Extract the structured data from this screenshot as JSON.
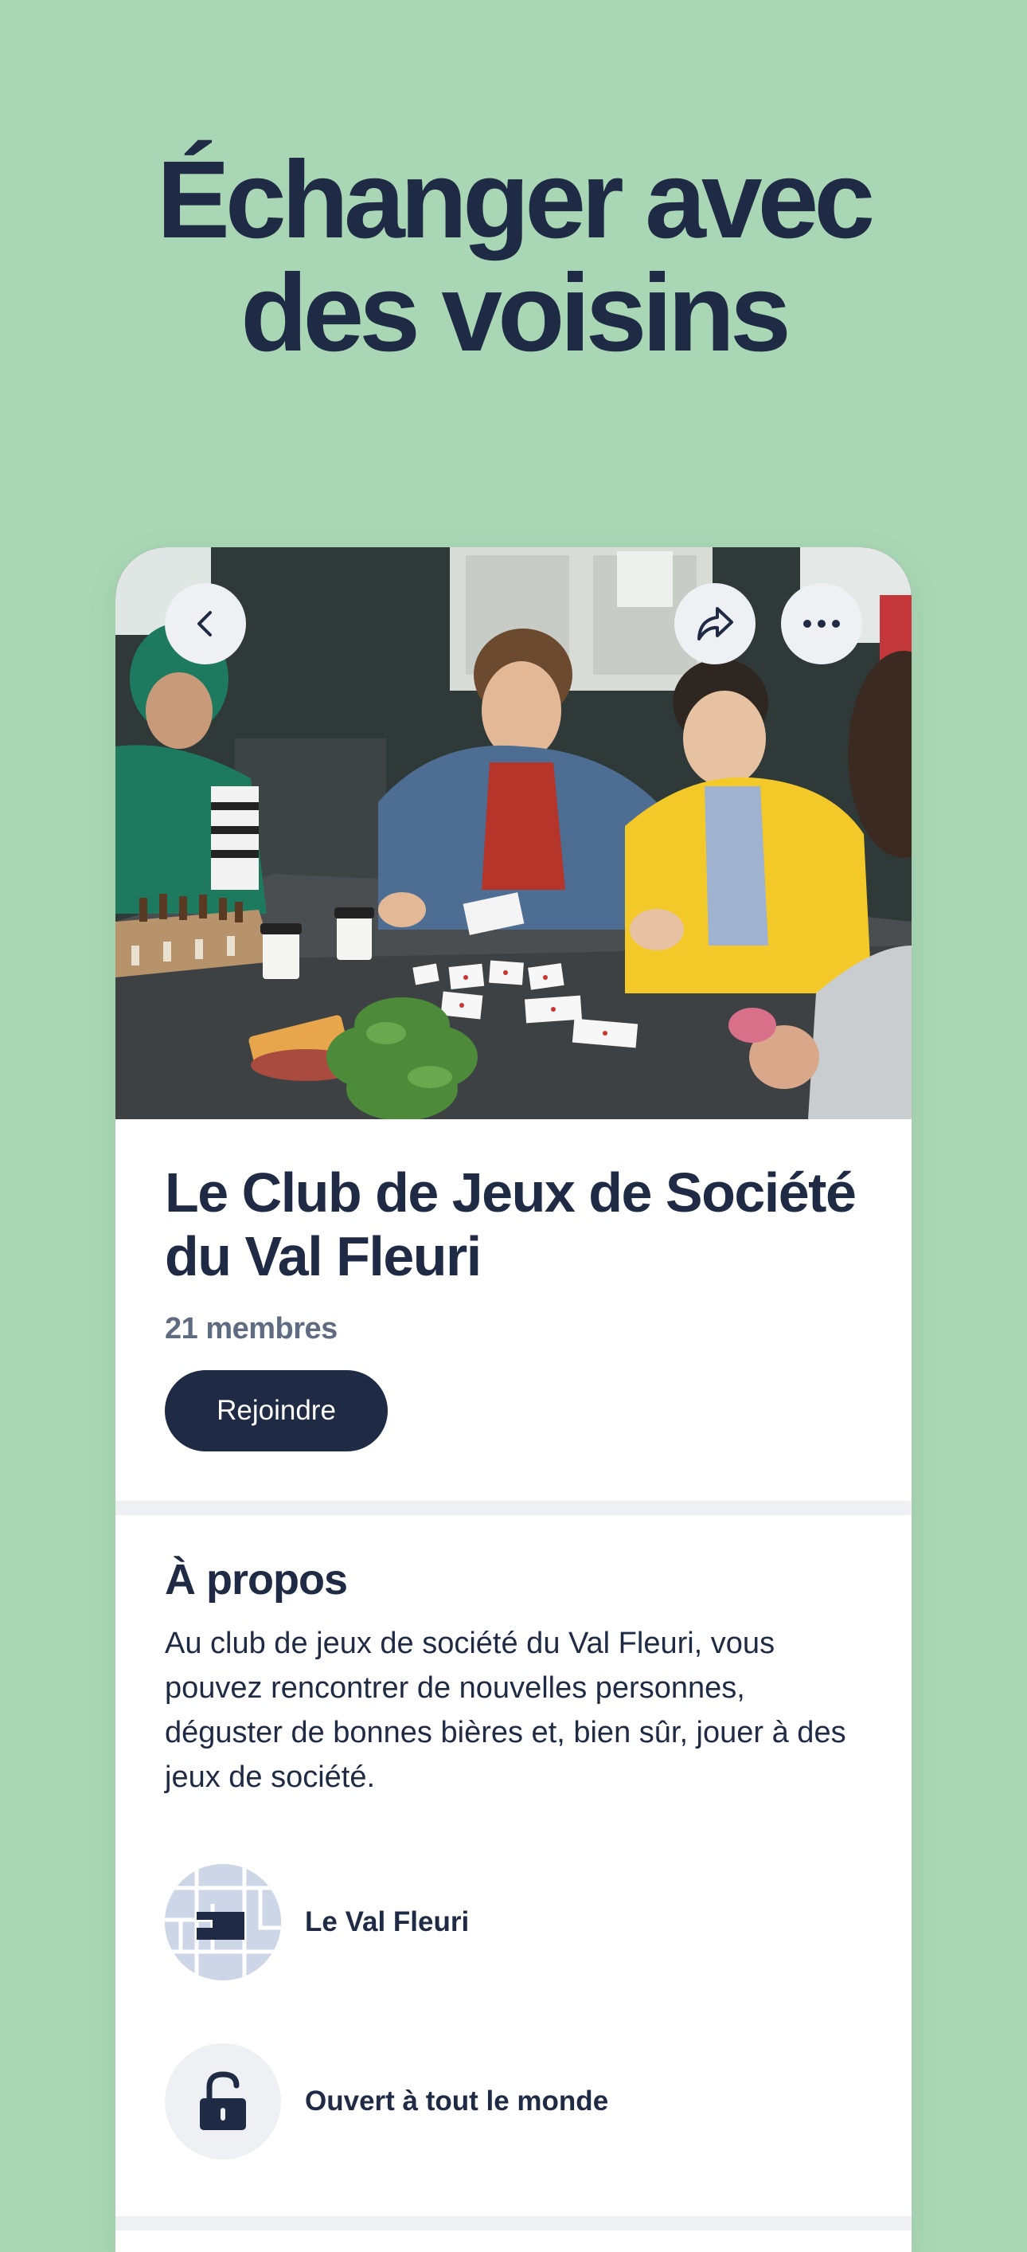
{
  "headline": {
    "line1": "Échanger avec",
    "line2": "des voisins"
  },
  "group": {
    "title": "Le Club de Jeux de Société du Val Fleuri",
    "members": "21 membres",
    "join_label": "Rejoindre"
  },
  "about": {
    "heading": "À propos",
    "text": "Au club de jeux de société du Val Fleuri, vous pouvez rencontrer de nouvelles personnes, déguster de bonnes bières et, bien sûr, jouer à des jeux de société."
  },
  "details": {
    "neighborhood": "Le Val Fleuri",
    "access": "Ouvert à tout le monde"
  },
  "icons": {
    "back": "chevron-left-icon",
    "share": "share-arrow-icon",
    "more": "more-dots-icon",
    "map": "map-thumbnail-icon",
    "lock": "unlocked-padlock-icon"
  },
  "colors": {
    "background": "#a9d7b5",
    "primary": "#1f2a44",
    "muted": "#5e6b80",
    "surface": "#ffffff",
    "divider": "#eef0f3"
  }
}
